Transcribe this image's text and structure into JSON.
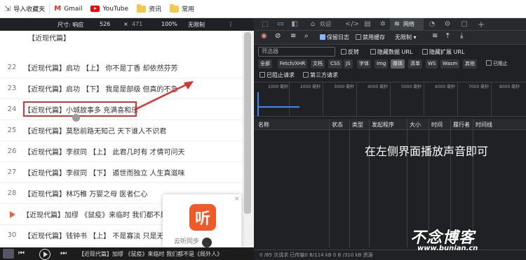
{
  "bookmarks": {
    "items": [
      {
        "label": "导入收藏夹",
        "icon": "import-icon"
      },
      {
        "label": "Gmail",
        "icon": "gmail-icon"
      },
      {
        "label": "YouTube",
        "icon": "youtube-icon"
      },
      {
        "label": "资讯",
        "icon": "folder-icon"
      },
      {
        "label": "常用",
        "icon": "folder-icon"
      }
    ]
  },
  "device_toolbar": {
    "size_label": "尺寸: 响应",
    "width": "526",
    "times": "×",
    "height": "471",
    "zoom": "100%",
    "throttle": "无限制"
  },
  "list": {
    "partial_top": "【近现代篇】",
    "rows": [
      {
        "num": "22",
        "text": "【近现代篇】启功 【上】 你不是丁香 却依然芬芳"
      },
      {
        "num": "23",
        "text": "【近现代篇】启功 【下】 我是是部级 但真的不急"
      },
      {
        "num": "24",
        "text": "【近现代篇】小城故事多 充满喜和乐"
      },
      {
        "num": "25",
        "text": "【近现代篇】莫愁前路无知己 天下谁人不识君"
      },
      {
        "num": "26",
        "text": "【近现代篇】李叔同 【上】 此君几时有 才情可问天"
      },
      {
        "num": "27",
        "text": "【近现代篇】李叔同 【下】 遁世而独立 人生真滋味"
      },
      {
        "num": "28",
        "text": "【近现代篇】林巧稚 万婴之母 医者仁心"
      },
      {
        "num": "",
        "text": "【近现代篇】加缪 《鼠疫》来临时 我们都不是"
      },
      {
        "num": "30",
        "text": "【近现代篇】钱钟书 【上】 不是寡淡 只是无趣"
      }
    ]
  },
  "popup": {
    "logo_char": "听",
    "label": "云听同步",
    "close": "×"
  },
  "player": {
    "now_playing": "【近现代篇】加缪 《鼠疫》来临时 我们都不是《局外人》"
  },
  "devtools": {
    "tabs": [
      {
        "label": "欢迎"
      },
      {
        "label": "网络"
      }
    ],
    "toolbar": {
      "preserve_log": "保留日志",
      "disable_cache": "禁用缓存",
      "throttle": "无限制"
    },
    "filter": {
      "placeholder": "筛选器",
      "invert": "反转",
      "hide_data_urls": "隐藏数据 URL",
      "hide_ext_urls": "隐藏扩展 URL"
    },
    "chips": [
      "全部",
      "Fetch/XHR",
      "文档",
      "CSS",
      "JS",
      "字体",
      "Img",
      "媒体",
      "清单",
      "WS",
      "Wasm",
      "其他"
    ],
    "selected_chip": "媒体",
    "blocked_cookies": "已阻止",
    "blocked_requests": "已阻止请求",
    "third_party": "第三方请求",
    "timeline_ticks": [
      "1000 毫秒",
      "2000 毫秒",
      "3000 毫秒",
      "4000 毫秒",
      "5000 毫秒",
      "6000 毫秒",
      "7000 毫秒",
      "8000 毫秒"
    ],
    "columns": [
      "名称",
      "状态",
      "类型",
      "发起程序",
      "大小",
      "时间",
      "履行者",
      "时间线"
    ],
    "overlay_text": "在左侧界面播放声音即可",
    "status_bar": "0 /85 次请求  已传输0 B/114 kB  0 B /310 kB 资源"
  },
  "watermark": {
    "main": "不念博客",
    "url": "www.bunian.cn"
  },
  "colors": {
    "accent_red": "#e03131",
    "devtools_bg": "#202124",
    "selected_blue": "#8ab4f8",
    "logo_orange": "#f05a28"
  }
}
